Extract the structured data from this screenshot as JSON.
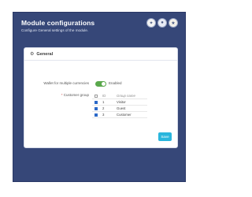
{
  "header": {
    "title": "Module configurations",
    "subtitle": "Configure General settings of the module."
  },
  "panel": {
    "title": "General",
    "wallet_label": "Wallet for multiple currencies",
    "wallet_state": "Enabled",
    "wallet_enabled": true,
    "group_label": "Customer group",
    "required_mark": "*",
    "table": {
      "headers": [
        "",
        "ID",
        "Group name"
      ],
      "rows": [
        {
          "checked": true,
          "id": "1",
          "name": "Visitor"
        },
        {
          "checked": true,
          "id": "2",
          "name": "Guest"
        },
        {
          "checked": true,
          "id": "3",
          "name": "Customer"
        }
      ]
    },
    "save_label": "Save"
  },
  "colors": {
    "background": "#364778",
    "toggle_on": "#5aa84c",
    "save_button": "#2ab6dd"
  }
}
